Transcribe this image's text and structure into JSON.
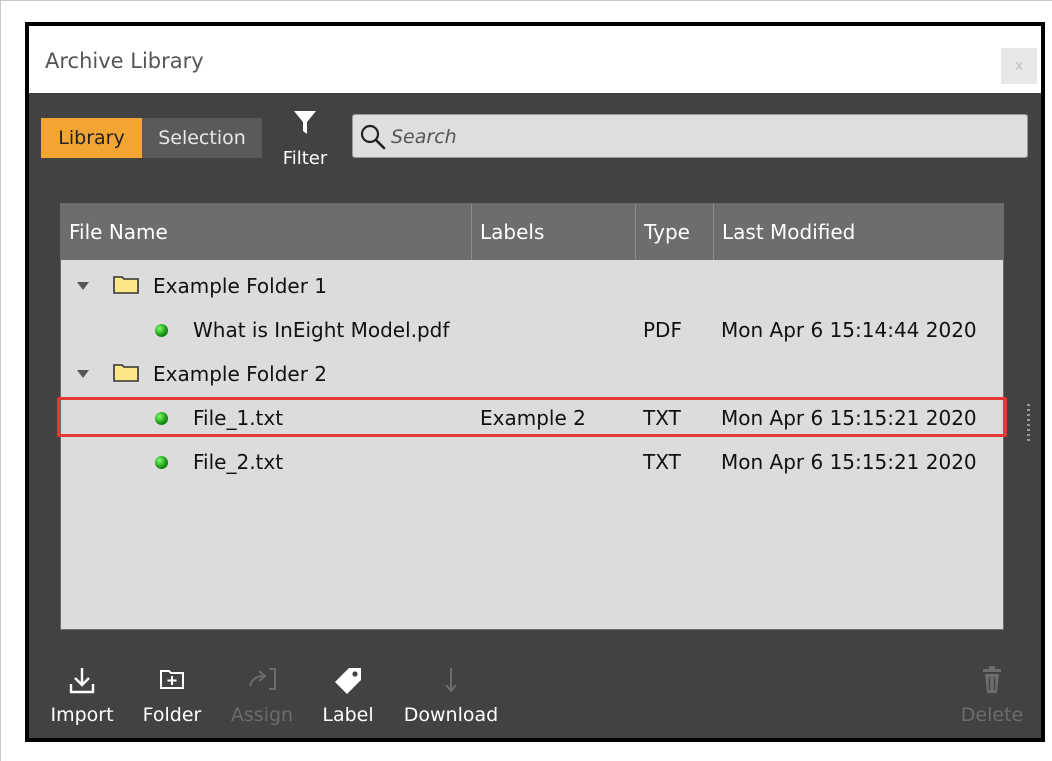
{
  "window": {
    "title": "Archive Library",
    "close_label": "x"
  },
  "tabs": [
    {
      "label": "Library",
      "active": true
    },
    {
      "label": "Selection",
      "active": false
    }
  ],
  "filter": {
    "label": "Filter",
    "icon": "filter-icon"
  },
  "search": {
    "placeholder": "Search",
    "value": "",
    "icon": "search-icon"
  },
  "table": {
    "columns": [
      "File Name",
      "Labels",
      "Type",
      "Last Modified"
    ],
    "rows": [
      {
        "kind": "folder",
        "name": "Example Folder 1",
        "labels": "",
        "type": "",
        "modified": ""
      },
      {
        "kind": "file",
        "name": "What is InEight Model.pdf",
        "labels": "",
        "type": "PDF",
        "modified": "Mon Apr 6 15:14:44 2020"
      },
      {
        "kind": "folder",
        "name": "Example Folder 2",
        "labels": "",
        "type": "",
        "modified": ""
      },
      {
        "kind": "file",
        "name": "File_1.txt",
        "labels": "Example 2",
        "type": "TXT",
        "modified": "Mon Apr 6 15:15:21 2020",
        "highlighted": true
      },
      {
        "kind": "file",
        "name": "File_2.txt",
        "labels": "",
        "type": "TXT",
        "modified": "Mon Apr 6 15:15:21 2020"
      }
    ]
  },
  "toolbar": {
    "import_label": "Import",
    "folder_label": "Folder",
    "assign_label": "Assign",
    "label_label": "Label",
    "download_label": "Download",
    "delete_label": "Delete"
  },
  "colors": {
    "accent": "#f3a533",
    "window_bg": "#424242",
    "highlight": "#e53935",
    "status_dot": "#1b9a16"
  }
}
